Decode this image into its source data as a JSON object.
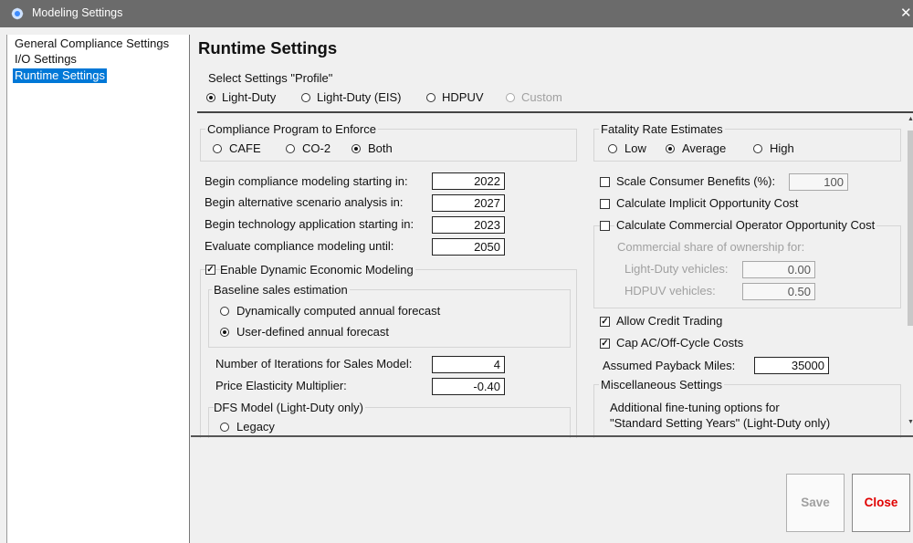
{
  "window": {
    "title": "Modeling Settings",
    "close_glyph": "✕"
  },
  "sidebar": {
    "items": [
      {
        "label": "General Compliance Settings",
        "selected": false
      },
      {
        "label": "I/O Settings",
        "selected": false
      },
      {
        "label": "Runtime Settings",
        "selected": true
      }
    ]
  },
  "main": {
    "title": "Runtime Settings",
    "profile": {
      "label": "Select Settings \"Profile\"",
      "options": [
        {
          "label": "Light-Duty",
          "checked": true,
          "enabled": true
        },
        {
          "label": "Light-Duty (EIS)",
          "checked": false,
          "enabled": true
        },
        {
          "label": "HDPUV",
          "checked": false,
          "enabled": true
        },
        {
          "label": "Custom",
          "checked": false,
          "enabled": false
        }
      ]
    }
  },
  "compliance_program": {
    "label": "Compliance Program to Enforce",
    "options": [
      {
        "label": "CAFE",
        "checked": false
      },
      {
        "label": "CO-2",
        "checked": false
      },
      {
        "label": "Both",
        "checked": true
      }
    ]
  },
  "years": [
    {
      "label": "Begin compliance modeling starting in:",
      "value": "2022"
    },
    {
      "label": "Begin alternative scenario analysis in:",
      "value": "2027"
    },
    {
      "label": "Begin technology application starting in:",
      "value": "2023"
    },
    {
      "label": "Evaluate compliance modeling until:",
      "value": "2050"
    }
  ],
  "dynamic": {
    "label": "Enable Dynamic Economic Modeling",
    "checked": true,
    "baseline": {
      "label": "Baseline sales estimation",
      "options": [
        {
          "label": "Dynamically computed annual forecast",
          "checked": false
        },
        {
          "label": "User-defined annual forecast",
          "checked": true
        }
      ]
    },
    "iterations": {
      "label": "Number of Iterations for Sales Model:",
      "value": "4"
    },
    "elasticity": {
      "label": "Price Elasticity Multiplier:",
      "value": "-0.40"
    },
    "dfs": {
      "label": "DFS Model (Light-Duty only)",
      "options": [
        {
          "label": "Legacy",
          "checked": false
        }
      ]
    }
  },
  "fatality": {
    "label": "Fatality Rate Estimates",
    "options": [
      {
        "label": "Low",
        "checked": false
      },
      {
        "label": "Average",
        "checked": true
      },
      {
        "label": "High",
        "checked": false
      }
    ]
  },
  "consumer": {
    "scale_label": "Scale Consumer Benefits (%):",
    "scale_value": "100",
    "scale_checked": false,
    "implicit_label": "Calculate Implicit Opportunity Cost",
    "implicit_checked": false
  },
  "commercial": {
    "label": "Calculate Commercial Operator Opportunity Cost",
    "checked": false,
    "share_label": "Commercial share of ownership for:",
    "ld_label": "Light-Duty vehicles:",
    "ld_value": "0.00",
    "hd_label": "HDPUV vehicles:",
    "hd_value": "0.50"
  },
  "credit": {
    "label": "Allow Credit Trading",
    "checked": true
  },
  "cap": {
    "label": "Cap AC/Off-Cycle Costs",
    "checked": true
  },
  "payback": {
    "label": "Assumed Payback Miles:",
    "value": "35000"
  },
  "misc": {
    "label": "Miscellaneous Settings",
    "line1": "Additional fine-tuning options for",
    "line2": "\"Standard Setting Years\" (Light-Duty only)"
  },
  "buttons": {
    "save": "Save",
    "close": "Close"
  },
  "colors": {
    "selection": "#0078d7",
    "close_text": "#e00000",
    "titlebar": "#6b6b6b"
  }
}
